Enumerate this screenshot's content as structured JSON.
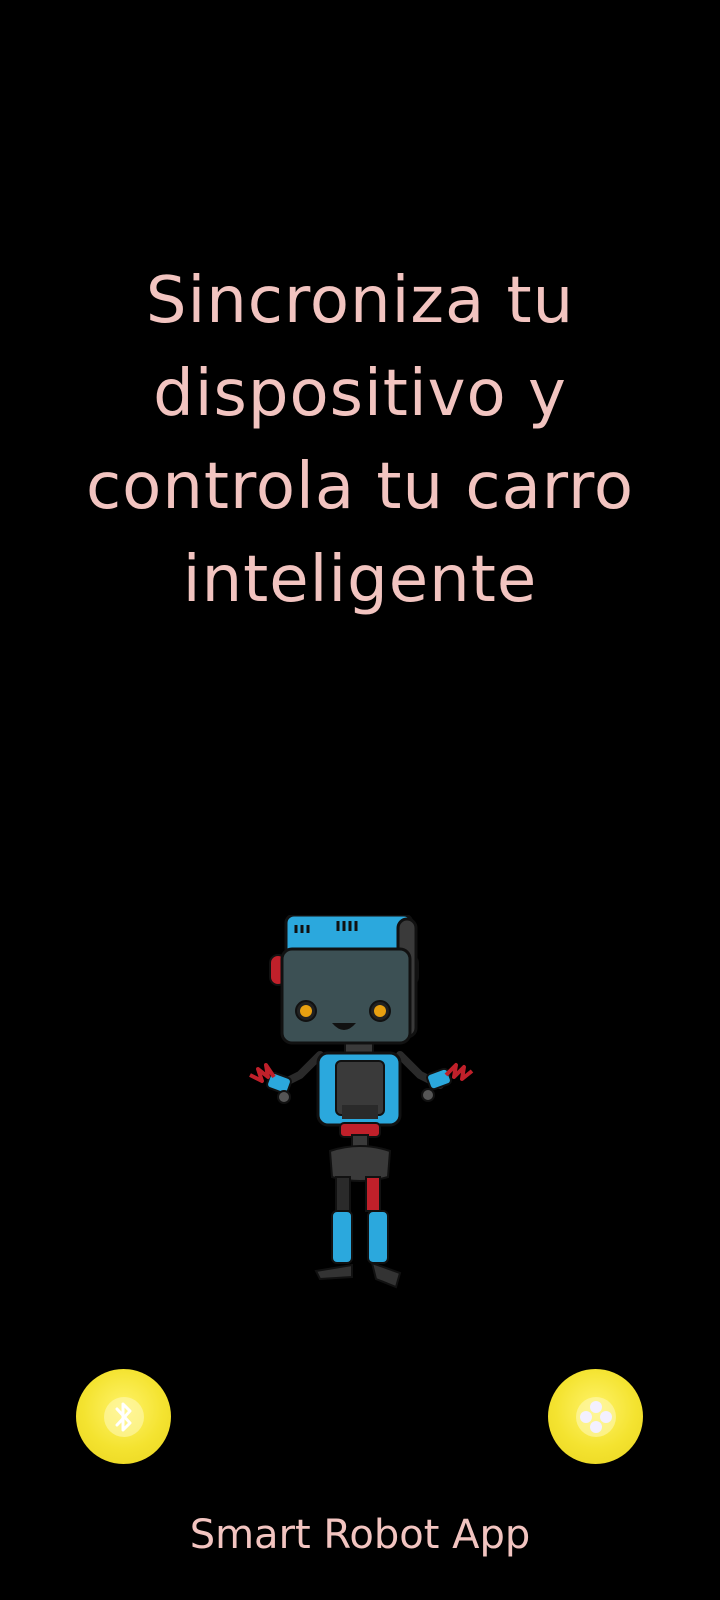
{
  "main": {
    "headline": "Sincroniza tu\ndispositivo y\ncontrola tu carro\ninteligente"
  },
  "actions": {
    "left_icon": "bluetooth-icon",
    "right_icon": "gamepad-icon"
  },
  "footer": {
    "app_name": "Smart Robot App"
  },
  "colors": {
    "background": "#000000",
    "text": "#f2c4c0",
    "button": "#f4e330",
    "robot_blue": "#2ba8dd",
    "robot_face": "#3c5054",
    "robot_red": "#c0202a"
  }
}
